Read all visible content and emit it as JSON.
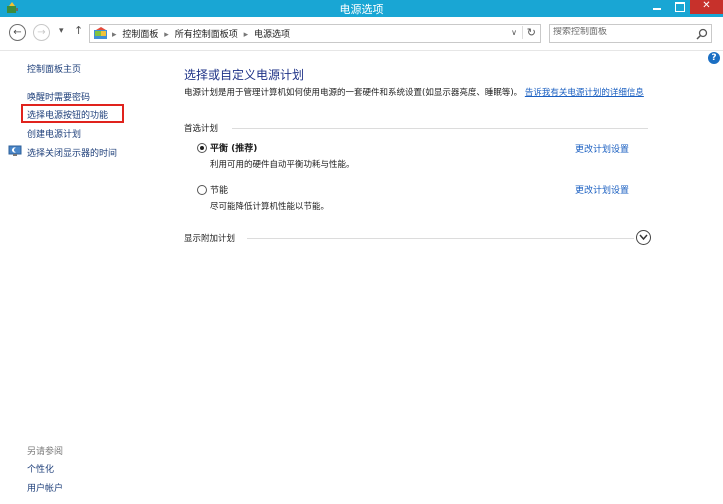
{
  "window": {
    "title": "电源选项",
    "close_glyph": "✕"
  },
  "nav": {
    "back_glyph": "←",
    "forward_glyph": "→",
    "recent_glyph": "▾",
    "up_glyph": "↑",
    "breadcrumbs": [
      "控制面板",
      "所有控制面板项",
      "电源选项"
    ],
    "breadcrumb_sep": "▸",
    "dropdown_glyph": "∨",
    "refresh_glyph": "↻",
    "search_placeholder": "搜索控制面板"
  },
  "help_glyph": "?",
  "sidebar": {
    "home": "控制面板主页",
    "links": [
      "唤醒时需要密码",
      "选择电源按钮的功能",
      "创建电源计划",
      "选择关闭显示器的时间"
    ],
    "see_also_label": "另请参阅",
    "see_also_links": [
      "个性化",
      "用户帐户"
    ]
  },
  "main": {
    "title": "选择或自定义电源计划",
    "description": "电源计划是用于管理计算机如何使用电源的一套硬件和系统设置(如显示器亮度、睡眠等)。",
    "description_link": "告诉我有关电源计划的详细信息",
    "preferred_label": "首选计划",
    "plans": [
      {
        "name": "平衡 (推荐)",
        "desc": "利用可用的硬件自动平衡功耗与性能。",
        "selected": true,
        "link": "更改计划设置"
      },
      {
        "name": "节能",
        "desc": "尽可能降低计算机性能以节能。",
        "selected": false,
        "link": "更改计划设置"
      }
    ],
    "more_plans_label": "显示附加计划"
  },
  "colors": {
    "titlebar": "#19a6d4",
    "close": "#c7312b",
    "link": "#1a5fc1",
    "title": "#1e3287",
    "highlight": "#e0231d"
  }
}
